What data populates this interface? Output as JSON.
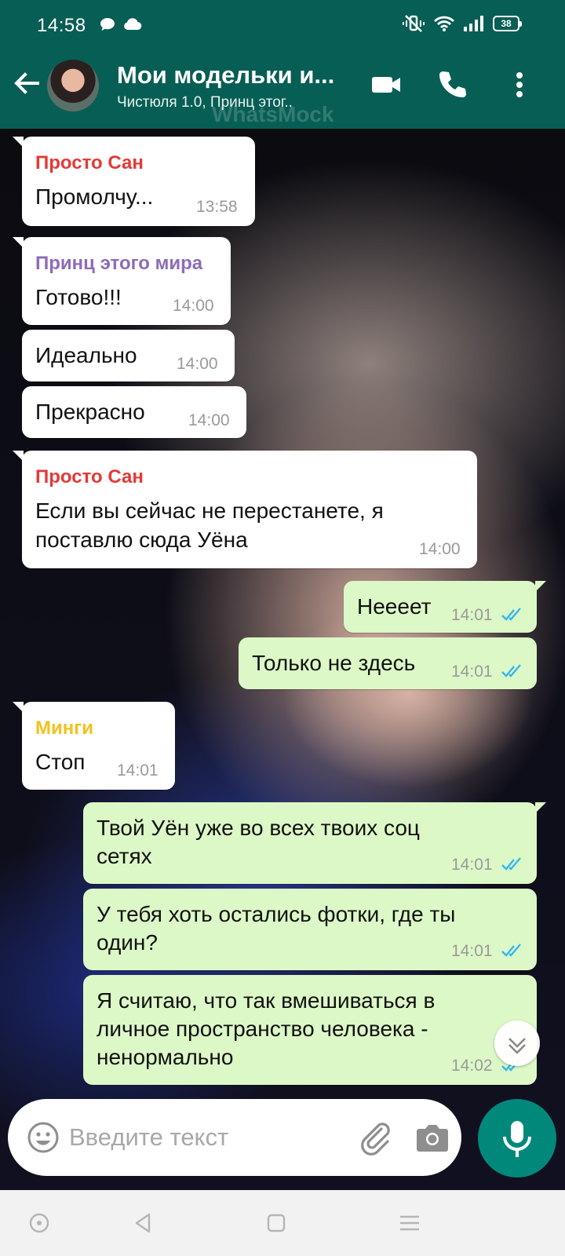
{
  "status_bar": {
    "time": "14:58",
    "battery": "38"
  },
  "header": {
    "title": "Мои модельки и...",
    "subtitle": "Чистюля 1.0, Принц этог..",
    "watermark": "WhatsMock"
  },
  "messages": [
    {
      "dir": "in",
      "sender": "Просто Сан",
      "sender_color": "#e53935",
      "text": "Промолчу...",
      "time": "13:58"
    },
    {
      "dir": "in",
      "sender": "Принц этого мира",
      "sender_color": "#8e6bb8",
      "text": "Готово!!!",
      "time": "14:00"
    },
    {
      "dir": "in",
      "text": "Идеально",
      "time": "14:00"
    },
    {
      "dir": "in",
      "text": "Прекрасно",
      "time": "14:00"
    },
    {
      "dir": "in",
      "sender": "Просто Сан",
      "sender_color": "#e53935",
      "text_lines": [
        "Если вы сейчас не перестанете, я",
        "поставлю сюда Уёна"
      ],
      "time": "14:00"
    },
    {
      "dir": "out",
      "text": "Неееет",
      "time": "14:01",
      "read": true
    },
    {
      "dir": "out",
      "text": "Только не здесь",
      "time": "14:01",
      "read": true
    },
    {
      "dir": "in",
      "sender": "Минги",
      "sender_color": "#f2c21b",
      "text": "Стоп",
      "time": "14:01"
    },
    {
      "dir": "out",
      "text_lines": [
        "Твой Уён уже во всех твоих соц",
        "сетях"
      ],
      "time": "14:01",
      "read": true
    },
    {
      "dir": "out",
      "text_lines": [
        "У тебя хоть остались фотки, где ты",
        "один?"
      ],
      "time": "14:01",
      "read": true
    },
    {
      "dir": "out",
      "text_lines": [
        "Я считаю, что так вмешиваться в",
        "личное пространство человека -",
        "ненормально"
      ],
      "time": "14:02",
      "read": true
    }
  ],
  "composer": {
    "placeholder": "Введите текст"
  },
  "colors": {
    "header": "#075e54",
    "accent": "#00897b",
    "out_bubble": "#dcf8c6",
    "read_ticks": "#34b7f1"
  },
  "icons": [
    "back-arrow-icon",
    "video-call-icon",
    "phone-icon",
    "more-vert-icon",
    "emoji-icon",
    "attach-icon",
    "camera-icon",
    "mic-icon",
    "chevron-down-icon"
  ]
}
